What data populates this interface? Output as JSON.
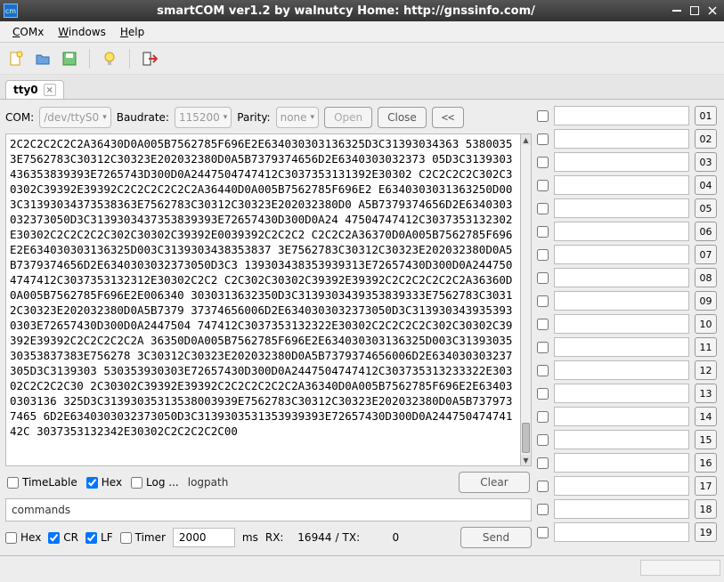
{
  "titlebar": {
    "app_icon_text": "cm",
    "title": "smartCOM ver1.2 by walnutcy  Home: http://gnssinfo.com/"
  },
  "menu": {
    "comx": "COMx",
    "windows": "Windows",
    "help": "Help"
  },
  "tab": {
    "label": "tty0"
  },
  "com_row": {
    "com_label": "COM:",
    "com_value": "/dev/ttyS0",
    "baud_label": "Baudrate:",
    "baud_value": "115200",
    "parity_label": "Parity:",
    "parity_value": "none",
    "open": "Open",
    "close": "Close",
    "collapse": "<<"
  },
  "hex_output": "2C2C2C2C2C2A36430D0A005B7562785F696E2E634030303136325D3C31393034363\n53800353E7562783C30312C30323E202032380D0A5B7379374656D2E6340303032373\n05D3C3139303436353839393E7265743D300D0A2447504747412C3037353131392E30302\nC2C2C2C2C302C30302C39392E39392C2C2C2C2C2C2A36440D0A005B7562785F696E2\nE6340303031363250D003C31393034373538363E7562783C30312C30323E202032380D0\nA5B7379374656D2E6340303032373050D3C3139303437353839393E72657430D300D0A24\n47504747412C3037353132302E30302C2C2C2C2C302C30302C39392E0039392C2C2C2\nC2C2C2A36370D0A005B7562785F696E2E634030303136325D003C3139303438353837\n3E7562783C30312C30323E202032380D0A5B7379374656D2E6340303032373050D3C3\n139303438353939313E72657430D300D0A2447504747412C3037353132312E30302C2C2\nC2C302C30302C39392E39392C2C2C2C2C2C2A36360D0A005B7562785F696E2E006340\n3030313632350D3C3139303439353839333E7562783C30312C30323E202032380D0A5B7379\n37374656006D2E6340303032373050D3C3139303439353930303E72657430D300D0A2447504\n747412C3037353132322E30302C2C2C2C2C302C30302C39392E39392C2C2C2C2C2A\n36350D0A005B7562785F696E2E634030303136325D003C3139303530353837383E756278\n3C30312C30323E202032380D0A5B7379374656006D2E634030303237305D3C3139303\n530353930303E72657430D300D0A2447504747412C303735313233322E30302C2C2C2C30\n2C30302C39392E39392C2C2C2C2C2C2A36340D0A005B7562785F696E2E634030303136\n325D3C31393035313538003939E7562783C30312C30323E202032380D0A5B7379737465\n6D2E6340303032373050D3C3139303531353939393E72657430D300D0A24475047474142C\n3037353132342E30302C2C2C2C2C00",
  "clear_row": {
    "timelable": "TimeLable",
    "timelable_checked": false,
    "hex": "Hex",
    "hex_checked": true,
    "log": "Log ...",
    "log_checked": false,
    "logpath": "logpath",
    "clear": "Clear"
  },
  "cmd_input": "commands",
  "send_row": {
    "hex": "Hex",
    "hex_checked": false,
    "cr": "CR",
    "cr_checked": true,
    "lf": "LF",
    "lf_checked": true,
    "timer": "Timer",
    "timer_checked": false,
    "timer_value": "2000",
    "ms_label": "ms",
    "rx_label": "RX:",
    "rx_value": "16944",
    "tx_sep": "/",
    "tx_label": "TX:",
    "tx_value": "0",
    "send": "Send"
  },
  "quick_buttons": [
    "01",
    "02",
    "03",
    "04",
    "05",
    "06",
    "07",
    "08",
    "09",
    "10",
    "11",
    "12",
    "13",
    "14",
    "15",
    "16",
    "17",
    "18",
    "19"
  ]
}
